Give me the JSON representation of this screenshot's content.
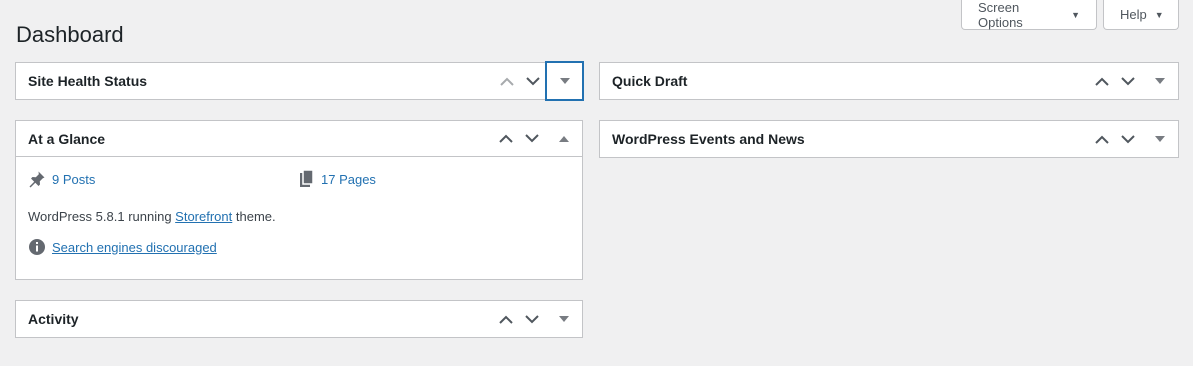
{
  "header": {
    "screen_options": "Screen Options",
    "help": "Help",
    "page_title": "Dashboard"
  },
  "widgets": {
    "site_health": {
      "title": "Site Health Status"
    },
    "at_a_glance": {
      "title": "At a Glance",
      "posts": "9 Posts",
      "pages": "17 Pages",
      "version_prefix": "WordPress 5.8.1 running ",
      "theme": "Storefront",
      "version_suffix": " theme.",
      "search_engines": "Search engines discouraged"
    },
    "activity": {
      "title": "Activity"
    },
    "quick_draft": {
      "title": "Quick Draft"
    },
    "events_news": {
      "title": "WordPress Events and News"
    }
  },
  "colors": {
    "background": "#f0f0f1",
    "link": "#2271b1",
    "border": "#c3c4c7",
    "focus": "#2271b1"
  },
  "icons": [
    "caret-down-icon",
    "chevron-up-icon",
    "chevron-down-icon",
    "triangle-down-icon",
    "triangle-up-icon",
    "pushpin-icon",
    "pages-icon",
    "info-icon"
  ]
}
